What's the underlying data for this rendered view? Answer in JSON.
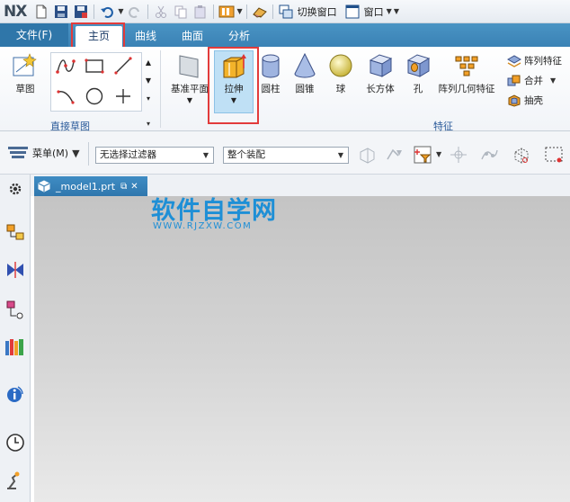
{
  "quick_access": {
    "logo": "NX",
    "switch_window": "切换窗口",
    "window_menu": "窗口"
  },
  "tabs": [
    {
      "label": "文件(F)"
    },
    {
      "label": "主页"
    },
    {
      "label": "曲线"
    },
    {
      "label": "曲面"
    },
    {
      "label": "分析"
    }
  ],
  "ribbon": {
    "sketch_label": "草图",
    "direct_sketch_group": "直接草图",
    "feature_group": "特征",
    "datum_plane": "基准平面",
    "extrude": "拉伸",
    "cylinder": "圆柱",
    "cone": "圆锥",
    "sphere": "球",
    "block": "长方体",
    "hole": "孔",
    "pattern_geometry": "阵列几何特征",
    "pattern_feature": "阵列特征",
    "unite": "合并",
    "shell": "抽壳"
  },
  "command_bar": {
    "menu": "菜单(M)",
    "filter": "无选择过滤器",
    "scope": "整个装配"
  },
  "document": {
    "tab_name": "_model1.prt"
  },
  "watermark": {
    "title": "软件自学网",
    "url": "WWW.RJZXW.COM"
  },
  "colors": {
    "highlight": "#e23b3b",
    "ribbon_tab_bar": "#3a82b5",
    "watermark": "#1e8fd6"
  }
}
